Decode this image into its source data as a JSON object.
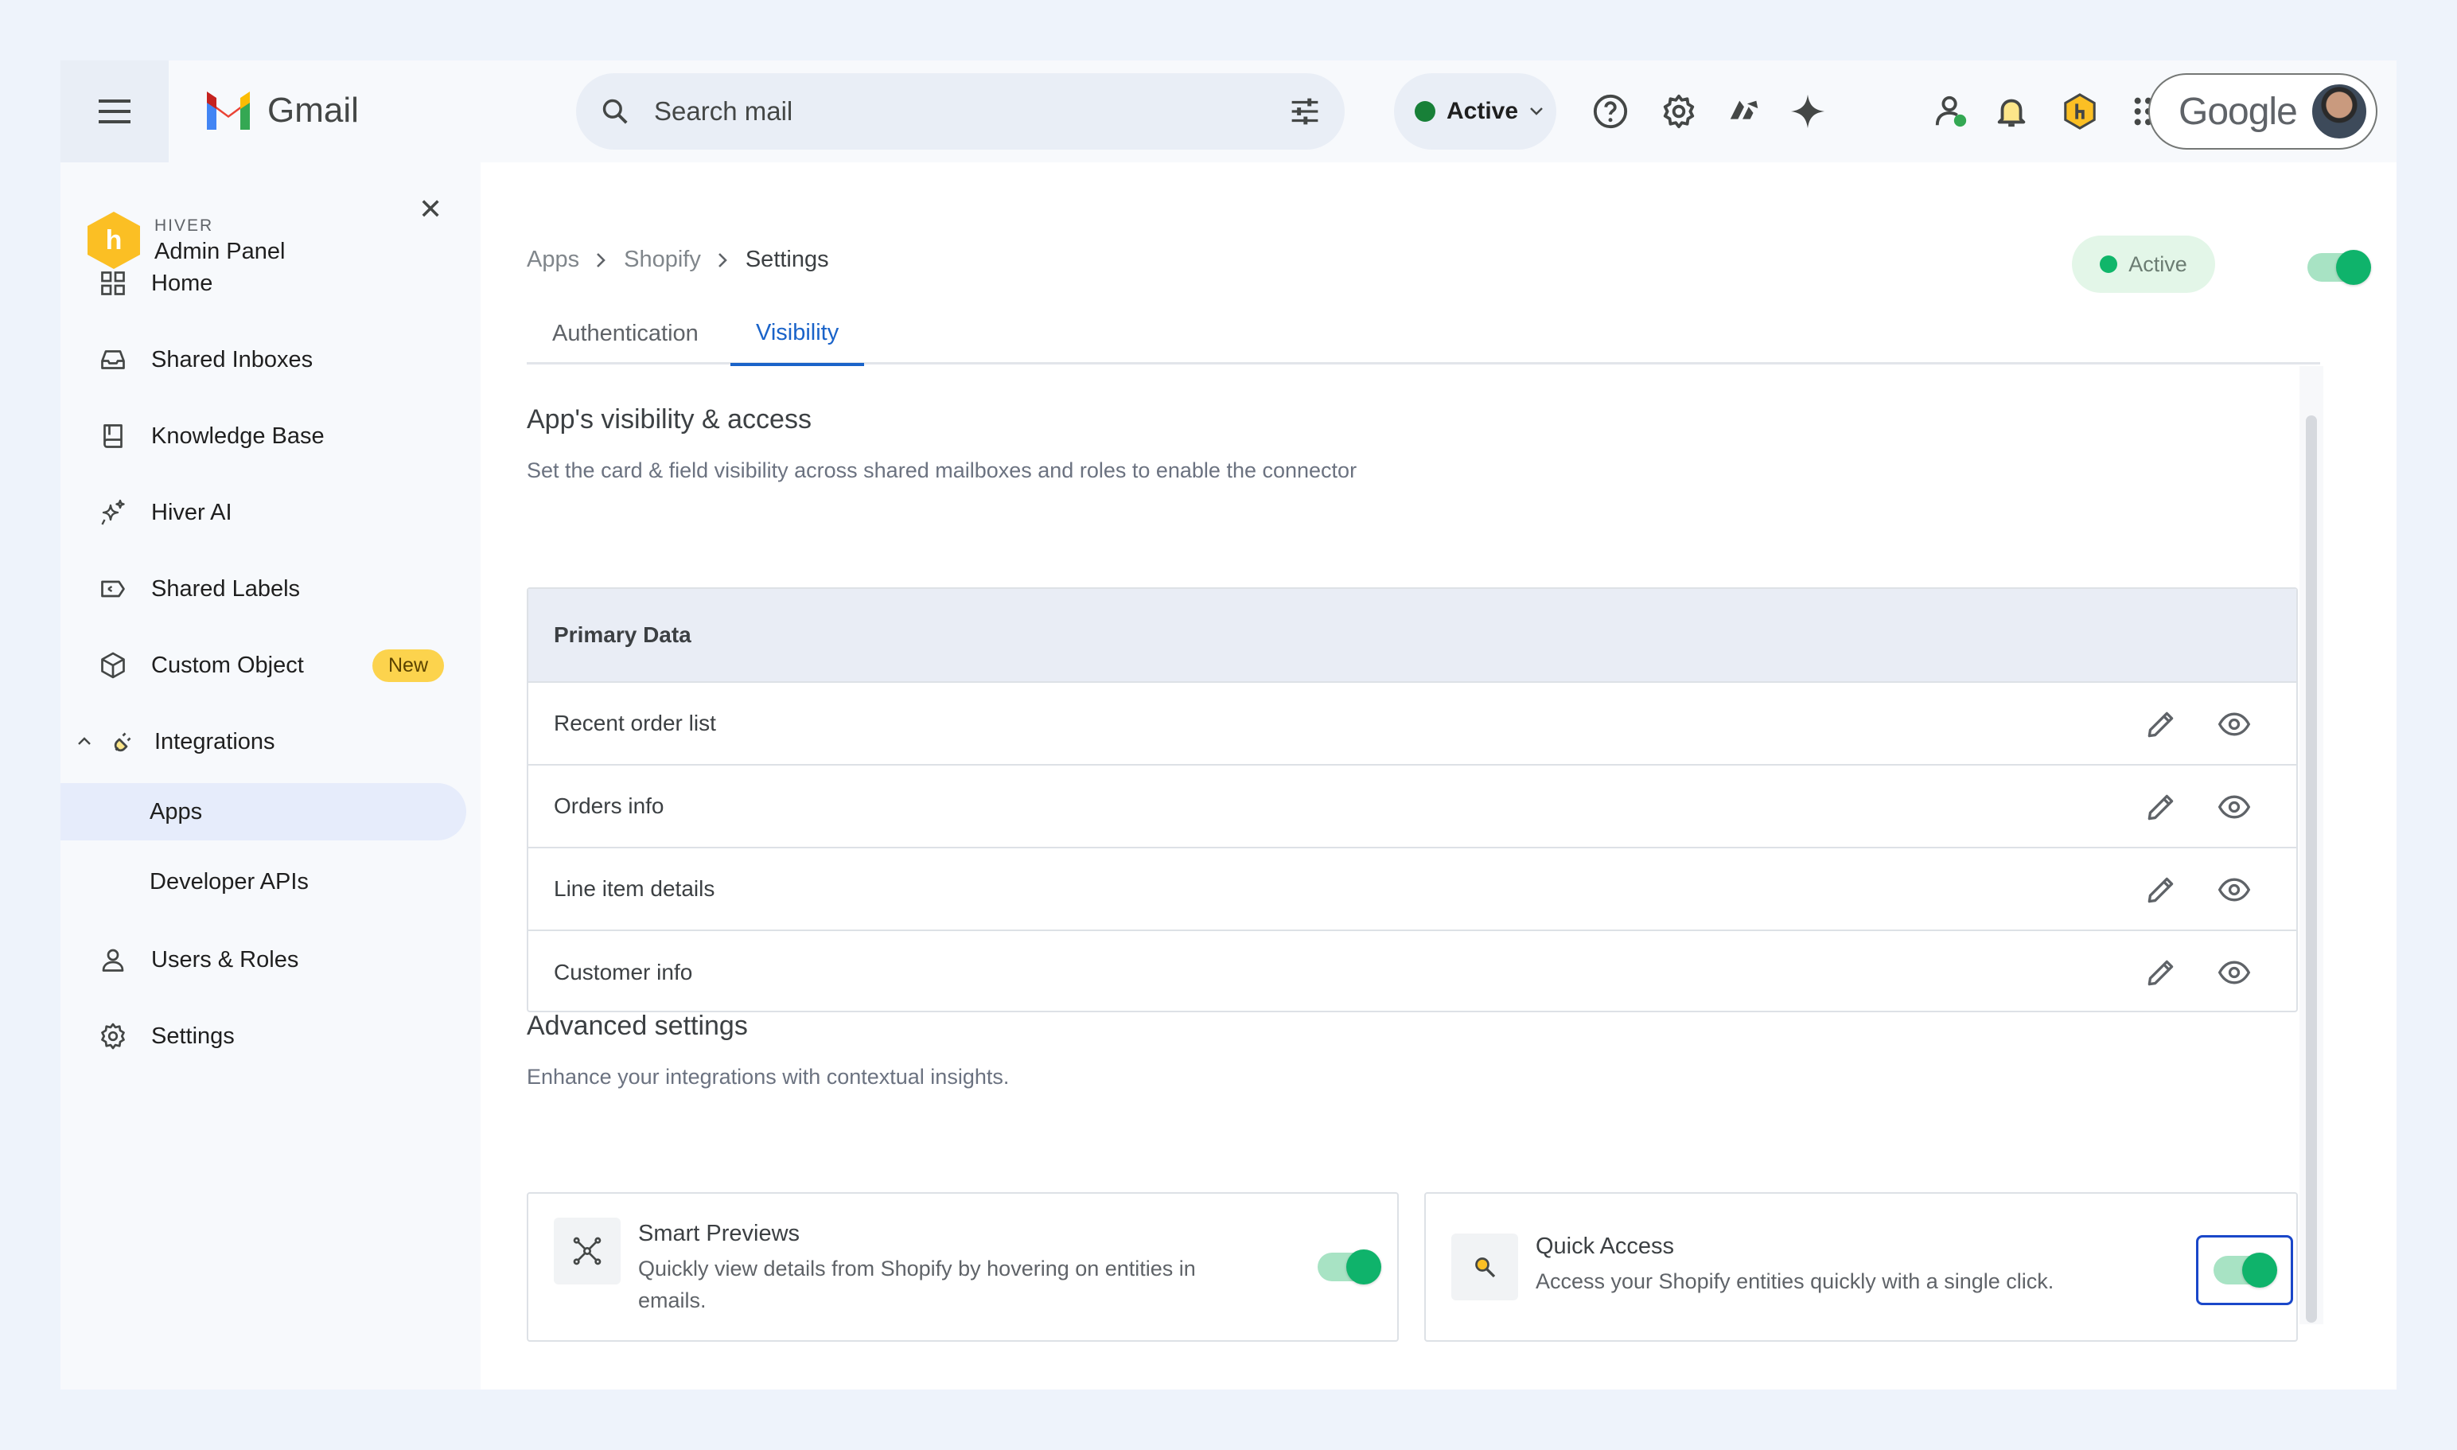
{
  "gmail": {
    "app_name": "Gmail",
    "search_placeholder": "Search mail",
    "status_label": "Active",
    "account_logo_text": "Google"
  },
  "sidebar": {
    "brand_small": "HIVER",
    "brand_title": "Admin Panel",
    "items": [
      {
        "label": "Home"
      },
      {
        "label": "Shared Inboxes"
      },
      {
        "label": "Knowledge Base"
      },
      {
        "label": "Hiver AI"
      },
      {
        "label": "Shared Labels"
      },
      {
        "label": "Custom Object",
        "badge": "New"
      },
      {
        "label": "Integrations"
      },
      {
        "label": "Apps"
      },
      {
        "label": "Developer APIs"
      },
      {
        "label": "Users & Roles"
      },
      {
        "label": "Settings"
      }
    ]
  },
  "breadcrumb": [
    "Apps",
    "Shopify",
    "Settings"
  ],
  "app_status": "Active",
  "tabs": [
    {
      "label": "Authentication"
    },
    {
      "label": "Visibility"
    }
  ],
  "visibility": {
    "title": "App's visibility & access",
    "subtitle": "Set the card & field visibility across shared mailboxes and roles to enable the connector",
    "table_header": "Primary Data",
    "rows": [
      "Recent order list",
      "Orders info",
      "Line item details",
      "Customer info"
    ]
  },
  "advanced": {
    "title": "Advanced settings",
    "subtitle": "Enhance your integrations with contextual insights.",
    "cards": [
      {
        "title": "Smart Previews",
        "desc": "Quickly view details from Shopify by hovering on entities in emails.",
        "enabled": true
      },
      {
        "title": "Quick Access",
        "desc": "Access your Shopify entities quickly with a single click.",
        "enabled": true
      }
    ]
  },
  "colors": {
    "accent_blue": "#1a63c9",
    "active_green": "#0fb36b",
    "badge_yellow": "#fcd34d"
  }
}
